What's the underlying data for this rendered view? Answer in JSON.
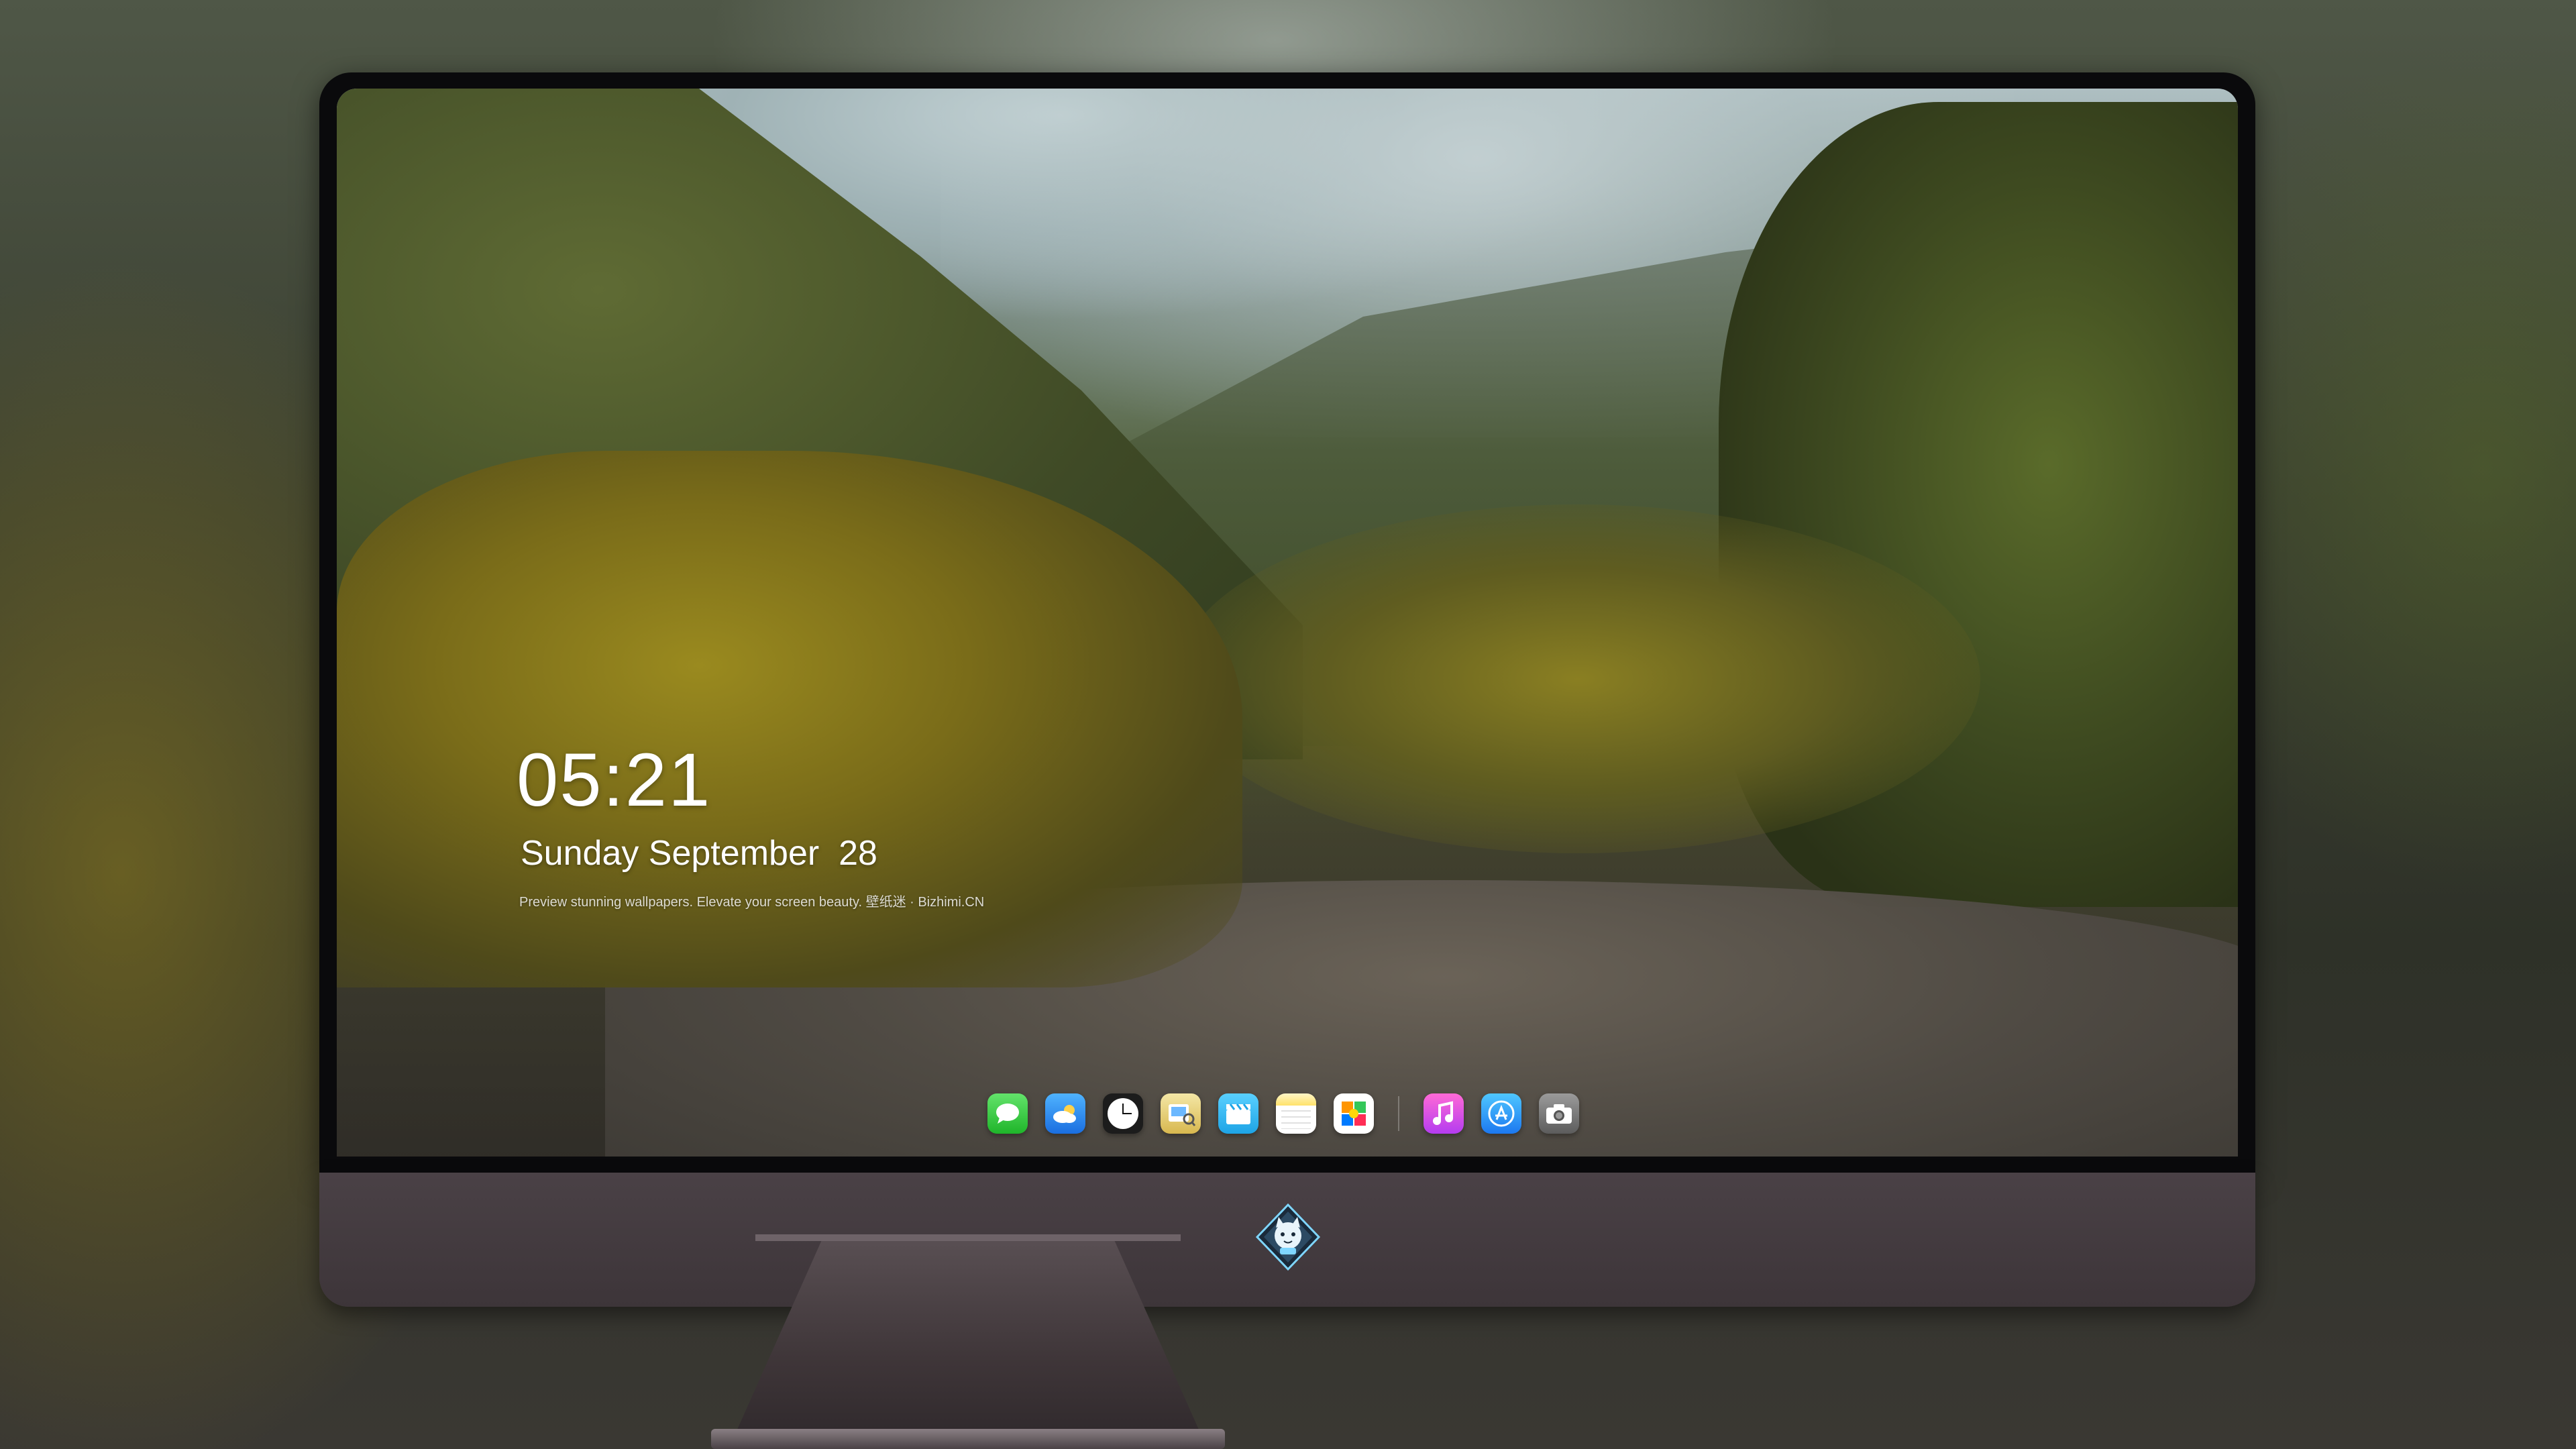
{
  "lock_screen": {
    "time": "05:21",
    "date": "Sunday September  28",
    "caption": "Preview stunning wallpapers. Elevate your screen beauty. 壁纸迷 · Bizhimi.CN"
  },
  "dock": {
    "apps": [
      {
        "name": "Messages",
        "icon": "messages-icon"
      },
      {
        "name": "Weather",
        "icon": "weather-icon"
      },
      {
        "name": "Clock",
        "icon": "clock-icon"
      },
      {
        "name": "Preview",
        "icon": "preview-icon"
      },
      {
        "name": "Clips",
        "icon": "clips-icon"
      },
      {
        "name": "Notes",
        "icon": "notes-icon"
      },
      {
        "name": "Photos",
        "icon": "photos-icon"
      },
      {
        "name": "Music",
        "icon": "music-icon"
      },
      {
        "name": "App Store",
        "icon": "app-store-icon"
      },
      {
        "name": "Camera",
        "icon": "camera-icon"
      }
    ]
  },
  "monitor": {
    "logo": "cat-mascot-logo",
    "bezel_color": "#0a0a0c",
    "chin_color": "#4a4146"
  },
  "colors": {
    "text": "#ffffff"
  }
}
